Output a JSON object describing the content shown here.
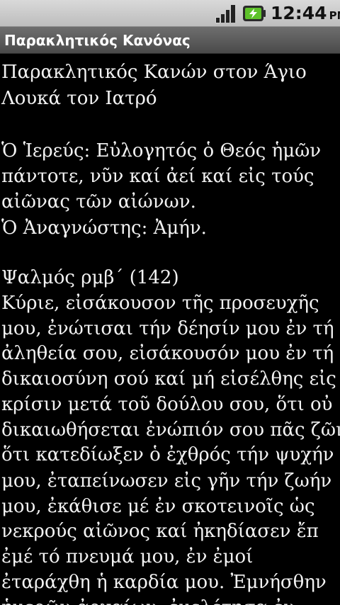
{
  "status_bar": {
    "time": "12:44",
    "ampm": "PM",
    "signal_icon": "signal-strength-icon",
    "battery_icon": "battery-charging-icon"
  },
  "app": {
    "title": "Παρακλητικός Κανόνας"
  },
  "content": {
    "lines": [
      "Παρακλητικός Κανών στον Άγιο",
      "Λουκά τον Ιατρό",
      "",
      "Ὁ Ἱερεύς: Εὐλογητός ὁ Θεός ἡμῶν",
      "πάντοτε, νῦν καί ἀεί καί εἰς τούς",
      "αἰῶνας τῶν αἰώνων.",
      "Ὁ Ἀναγνώστης: Ἀμήν.",
      "",
      "Ψαλμός ρμβ΄ (142)",
      "Κύριε, εἰσάκουσον τῆς προσευχῆς",
      "μου, ἐνώτισαι τήν δέησίν μου ἐν τή",
      "ἀληθεία σου, εἰσάκουσόν μου ἐν τή",
      "δικαιοσύνη σού καί μή εἰσέλθης εἰς",
      "κρίσιν μετά τοῦ δούλου σου, ὅτι οὐ",
      "δικαιωθήσεται ἐνώπιόν σου πᾶς ζῶν.",
      "ὅτι κατεδίωξεν ὁ ἐχθρός τήν ψυχήν",
      "μου, ἐταπείνωσεν εἰς γῆν τήν ζωήν",
      "μου, ἐκάθισε μέ ἐν σκοτεινοῖς ὡς",
      "νεκρούς αἰῶνος καί ἠκηδίασεν ἔπ",
      "ἐμέ τό πνευμά μου, ἐν ἐμοί",
      "ἐταράχθη ἡ καρδία μου. Ἐμνήσθην",
      "ἡμερῶν ἀρχαίων, ἐμελέτησα ἐν"
    ]
  }
}
